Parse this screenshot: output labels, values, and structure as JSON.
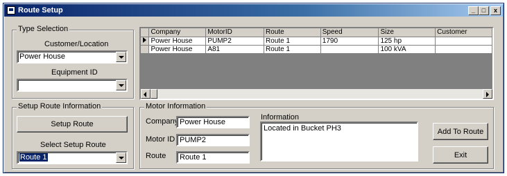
{
  "window": {
    "title": "Route Setup",
    "caption_buttons": [
      "_",
      "□",
      "x"
    ]
  },
  "type_selection": {
    "legend": "Type Selection",
    "customer_label": "Customer/Location",
    "customer_value": "Power House",
    "equipment_label": "Equipment ID",
    "equipment_value": ""
  },
  "setup_route_info": {
    "legend": "Setup Route Information",
    "setup_button": "Setup Route",
    "select_label": "Select Setup Route",
    "select_value": "Route 1"
  },
  "grid": {
    "columns": [
      "Company",
      "MotorID",
      "Route",
      "Speed",
      "Size",
      "Customer"
    ],
    "rows": [
      [
        "Power House",
        "PUMP2",
        "Route 1",
        "1790",
        "125 hp",
        ""
      ],
      [
        "Power House",
        "A81",
        "Route 1",
        "",
        "100 kVA",
        ""
      ]
    ]
  },
  "motor_info": {
    "legend": "Motor Information",
    "company_label": "Company",
    "company_value": "Power House",
    "motor_id_label": "Motor ID",
    "motor_id_value": "PUMP2",
    "route_label": "Route",
    "route_value": "Route 1",
    "information_label": "Information",
    "information_value": "Located in Bucket PH3"
  },
  "actions": {
    "add_to_route": "Add To Route",
    "exit": "Exit"
  },
  "colors": {
    "titlebar": "#0a246a",
    "face": "#d4d0c8",
    "selection": "#0a246a"
  }
}
